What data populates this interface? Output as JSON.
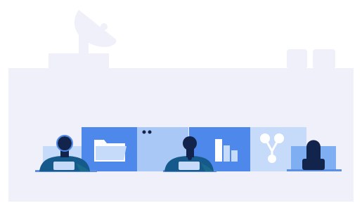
{
  "illustration": {
    "palette": {
      "background": "#FFFFFF",
      "building": "#F0F0FB",
      "panel_dark": "#4D88EA",
      "panel_mid": "#7FAEF2",
      "panel_light": "#A9C8F6",
      "panel_pale": "#C6DBFA",
      "person_hair": "#12234C",
      "person_shirt": "#155A8A",
      "person_shirt_accent": "#1A6A8C",
      "desk_line": "#5B8FE2",
      "white": "#FFFFFF"
    },
    "elements": [
      {
        "name": "satellite-dish-icon"
      },
      {
        "name": "folder-icon"
      },
      {
        "name": "bar-chart-icon"
      },
      {
        "name": "network-graph-icon"
      },
      {
        "name": "person-at-desk-left"
      },
      {
        "name": "person-at-desk-center"
      },
      {
        "name": "person-at-desk-right"
      }
    ]
  }
}
